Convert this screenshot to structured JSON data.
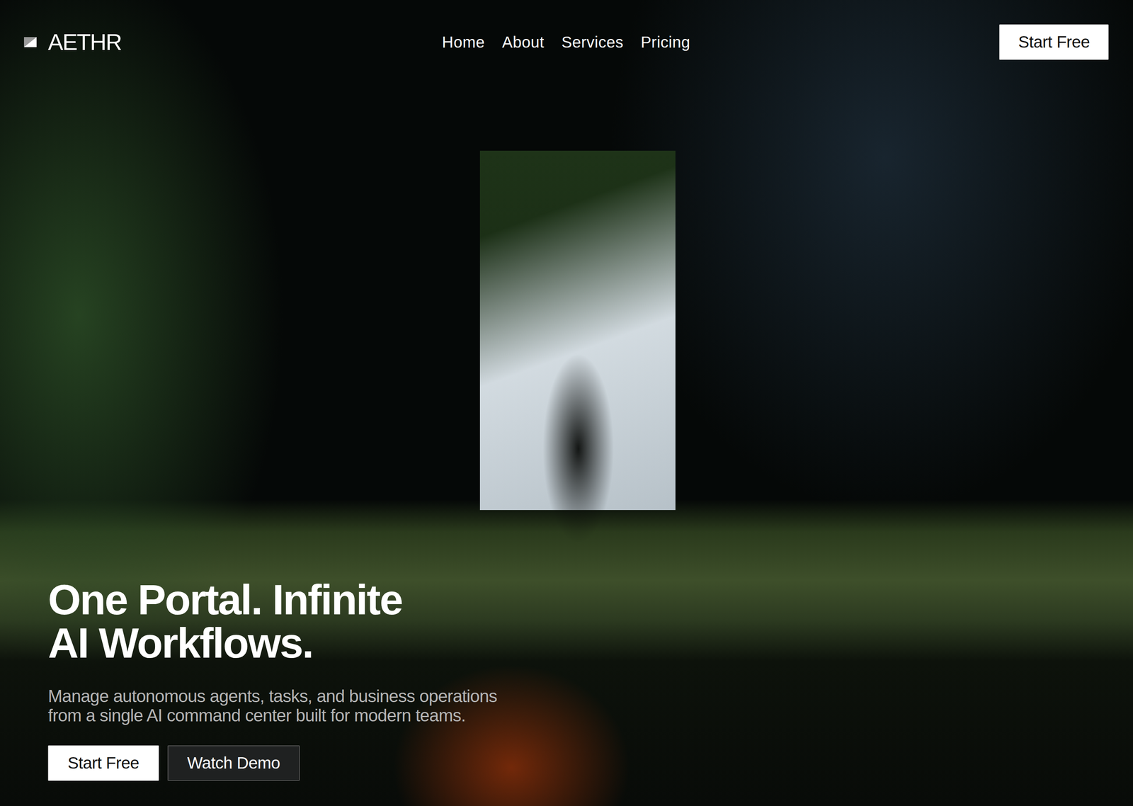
{
  "brand": {
    "name": "AETHR"
  },
  "nav": {
    "items": [
      {
        "label": "Home"
      },
      {
        "label": "About"
      },
      {
        "label": "Services"
      },
      {
        "label": "Pricing"
      }
    ]
  },
  "header_button": {
    "label": "Start Free"
  },
  "hero": {
    "title_lines": [
      "One Portal. Infinite",
      "AI Workflows."
    ],
    "subtitle_lines": [
      "Manage autonomous agents, tasks, and business operations",
      "from a single AI command center built for modern teams."
    ],
    "buttons": [
      {
        "label": "Start Free",
        "kind": "primary"
      },
      {
        "label": "Watch Demo",
        "kind": "secondary"
      }
    ]
  }
}
